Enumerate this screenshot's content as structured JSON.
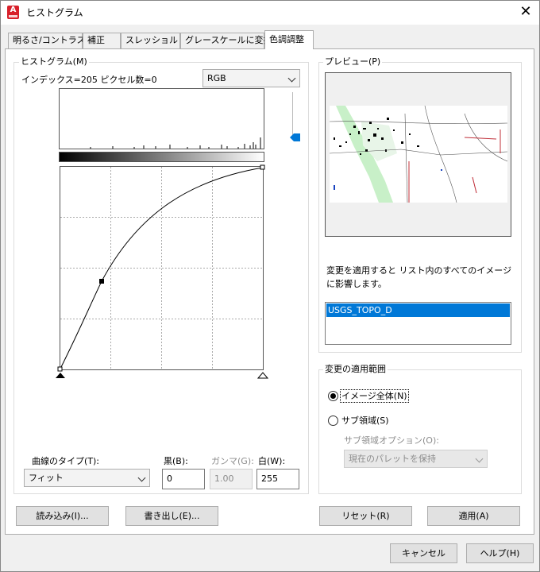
{
  "window": {
    "title": "ヒストグラム",
    "close_glyph": "✕"
  },
  "tabs": [
    {
      "label": "明るさ/コントラスト"
    },
    {
      "label": "補正"
    },
    {
      "label": "スレッショルド"
    },
    {
      "label": "グレースケールに変換"
    },
    {
      "label": "色調調整",
      "active": true
    }
  ],
  "histogram": {
    "group_label": "ヒストグラム(M)",
    "info": "インデックス=205 ピクセル数=0",
    "channel": "RGB"
  },
  "curve": {
    "type_label": "曲線のタイプ(T):",
    "type_value": "フィット",
    "black_label": "黒(B):",
    "black_value": "0",
    "gamma_label": "ガンマ(G):",
    "gamma_value": "1.00",
    "white_label": "白(W):",
    "white_value": "255"
  },
  "preview": {
    "group_label": "プレビュー(P)",
    "note": "変更を適用すると リスト内のすべてのイメージに影響します。",
    "list_items": [
      "USGS_TOPO_D"
    ]
  },
  "scope": {
    "group_label": "変更の適用範囲",
    "option_all": "イメージ全体(N)",
    "option_sub": "サブ領域(S)",
    "sub_option_label": "サブ領域オプション(O):",
    "sub_option_value": "現在のパレットを保持"
  },
  "buttons": {
    "load": "読み込み(I)...",
    "export": "書き出し(E)...",
    "reset": "リセット(R)",
    "apply": "適用(A)",
    "cancel": "キャンセル",
    "help": "ヘルプ(H)"
  },
  "colors": {
    "accent": "#0078d7",
    "selection": "#0078d7",
    "app_icon": "#d8202a"
  }
}
